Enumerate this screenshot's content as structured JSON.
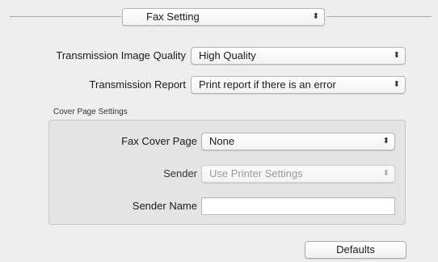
{
  "header": {
    "panel_select": {
      "value": "Fax Setting"
    }
  },
  "settings": {
    "transmission_image_quality": {
      "label": "Transmission Image Quality",
      "value": "High Quality"
    },
    "transmission_report": {
      "label": "Transmission Report",
      "value": "Print report if there is an error"
    }
  },
  "cover_page": {
    "title": "Cover Page Settings",
    "fax_cover_page": {
      "label": "Fax Cover Page",
      "value": "None"
    },
    "sender": {
      "label": "Sender",
      "value": "Use Printer Settings",
      "disabled": true
    },
    "sender_name": {
      "label": "Sender Name",
      "value": ""
    }
  },
  "footer": {
    "defaults_label": "Defaults"
  },
  "icons": {
    "popup_arrows": "updown-chevron-icon"
  }
}
